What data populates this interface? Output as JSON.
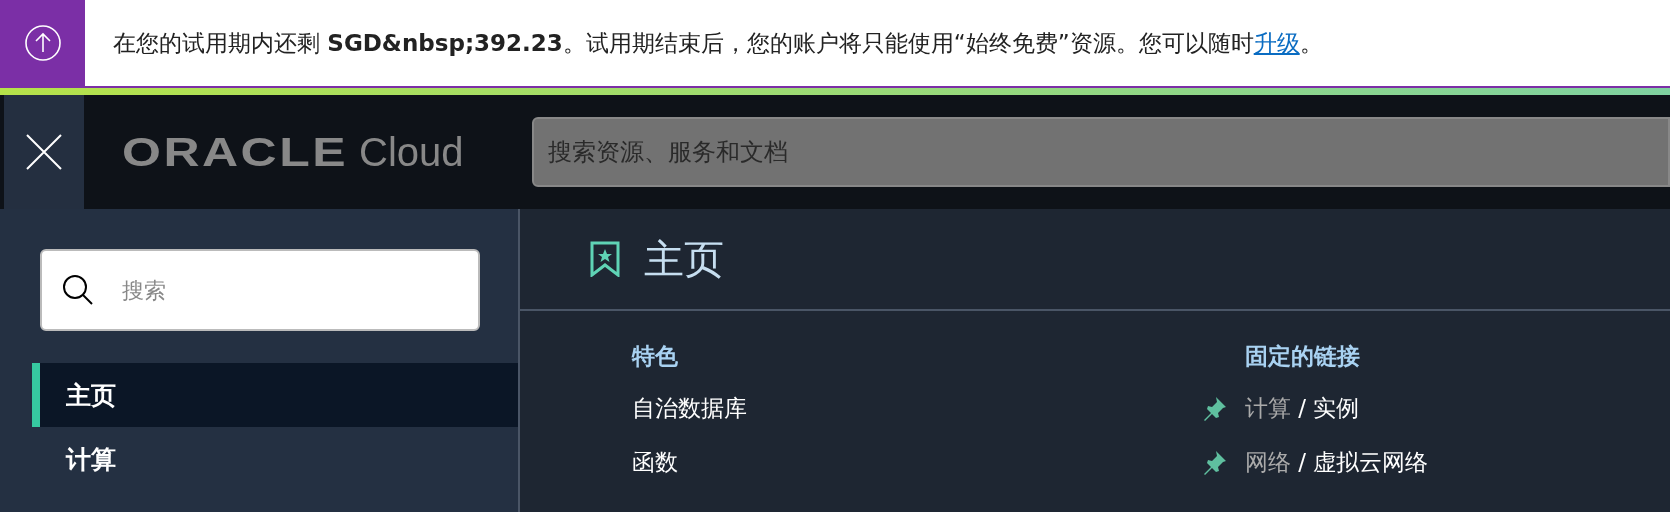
{
  "banner": {
    "text_before": "在您的试用期内还剩 **SGD&nbsp;392.23**。试用期结束后，您的账户将只能使用“始终免费”资源。您可以随时",
    "link": "升级",
    "text_after": "。"
  },
  "header": {
    "logo": "ORACLE",
    "logo_suffix": "Cloud",
    "search": {
      "placeholder": "搜索资源、服务和文档"
    }
  },
  "sidebar": {
    "search": {
      "placeholder": "搜索"
    },
    "items": [
      {
        "label": "主页",
        "selected": true
      },
      {
        "label": "计算",
        "selected": false
      }
    ]
  },
  "page": {
    "title": "主页",
    "featured": {
      "heading": "特色",
      "items": [
        "自治数据库",
        "函数"
      ]
    },
    "pinned": {
      "heading": "固定的链接",
      "items": [
        {
          "section": "计算",
          "separator": "/",
          "page": "实例"
        },
        {
          "section": "网络",
          "separator": "/",
          "page": "虚拟云网络"
        }
      ]
    }
  }
}
